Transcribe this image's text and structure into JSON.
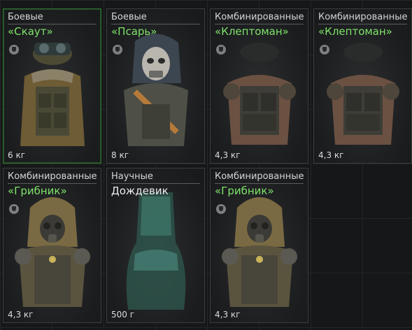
{
  "items": [
    {
      "category": "Боевые",
      "name": "«Скаут»",
      "weight": "6 кг"
    },
    {
      "category": "Боевые",
      "name": "«Псарь»",
      "weight": "8 кг"
    },
    {
      "category": "Комбинированные",
      "name": "«Клептоман»",
      "weight": "4,3 кг"
    },
    {
      "category": "Комбинированные",
      "name": "«Клептоман»",
      "weight": "4,3 кг"
    },
    {
      "category": "Комбинированные",
      "name": "«Грибник»",
      "weight": "4,3 кг"
    },
    {
      "category": "Научные",
      "name": "Дождевик",
      "weight": "500 г"
    },
    {
      "category": "Комбинированные",
      "name": "«Грибник»",
      "weight": "4,3 кг"
    }
  ],
  "colors": {
    "green_name": "#7ee36a",
    "white_name": "#ececec",
    "selected_border": "#2f6b34"
  },
  "icons": [
    "shield-icon"
  ]
}
